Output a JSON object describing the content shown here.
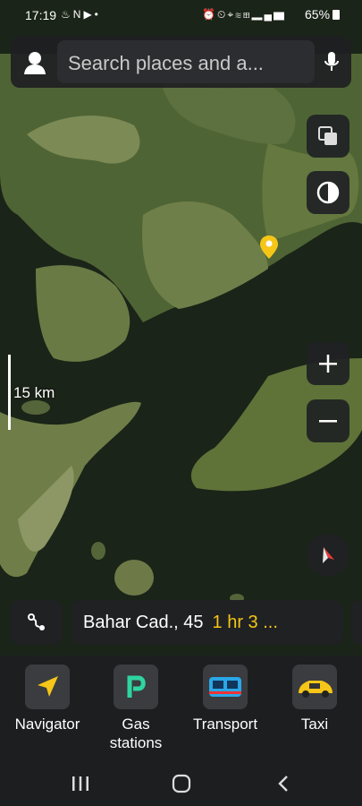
{
  "status_bar": {
    "time": "17:19",
    "left_icons": [
      "flame-icon",
      "n-icon",
      "youtube-icon",
      "dot-icon"
    ],
    "right_icons": [
      "alarm-icon",
      "clock-icon",
      "location-icon",
      "wifi-icon",
      "volte-icon",
      "signal-icon"
    ],
    "battery": "65%"
  },
  "search": {
    "placeholder": "Search places and a..."
  },
  "map": {
    "scale_label": "15 km",
    "controls": [
      "layers-icon",
      "theme-icon",
      "zoom-in-icon",
      "zoom-out-icon",
      "compass-icon"
    ]
  },
  "route": {
    "address": "Bahar Cad., 45",
    "eta": "1 hr 3 ..."
  },
  "apps": [
    {
      "label": "Navigator",
      "icon": "navigator-icon",
      "color": "#f5c518"
    },
    {
      "label": "Gas\nstations",
      "icon": "gas-stations-icon",
      "color": "#2fd4a0"
    },
    {
      "label": "Transport",
      "icon": "transport-icon",
      "color": "#2aa7e8"
    },
    {
      "label": "Taxi",
      "icon": "taxi-icon",
      "color": "#f5c518"
    }
  ],
  "colors": {
    "accent": "#f5c518",
    "panel": "#1f2123"
  }
}
